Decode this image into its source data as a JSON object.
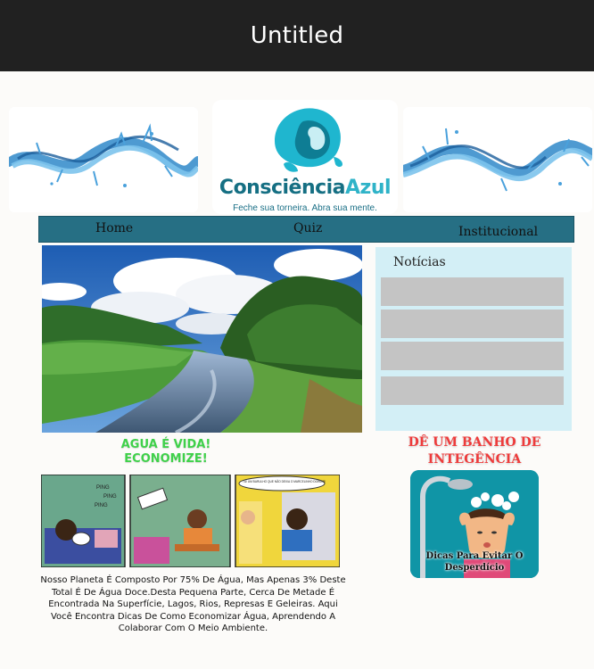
{
  "window": {
    "title": "Untitled"
  },
  "logo": {
    "name_part1": "Consciência",
    "name_part2": "Azul",
    "tagline": "Feche sua torneira. Abra sua mente."
  },
  "nav": {
    "items": [
      "Home",
      "Quiz",
      "Institucional"
    ]
  },
  "news": {
    "title": "Notícias",
    "items": [
      "",
      "",
      "",
      ""
    ]
  },
  "captions": {
    "left_line1": "AGUA É VIDA!",
    "left_line2": "ECONOMIZE!",
    "right_line1": "DÊ UM BANHO DE",
    "right_line2": "INTEGÊNCIA"
  },
  "comic": {
    "sound1": "PING",
    "sound2": "PING",
    "sound3": "PING",
    "speech": "TÁ! UM BARULHO QUE NÃO DEIXA O MARCELINHO DORMIR!"
  },
  "body_text": "Nosso Planeta É Composto Por 75% De Água, Mas Apenas 3% Deste Total É De Água Doce.Desta Pequena Parte, Cerca De Metade É Encontrada Na Superfície, Lagos, Rios, Represas E Geleiras. Aqui Você Encontra Dicas De Como Economizar Água, Aprendendo A Colaborar Com O Meio Ambiente.",
  "tips": {
    "label_line1": "Dicas Para Evitar O",
    "label_line2": "Desperdício"
  },
  "colors": {
    "titlebar": "#212121",
    "nav": "#266f84",
    "news_bg": "#d3eff6",
    "news_item": "#c4c4c4",
    "caption_green": "#3fd14a",
    "caption_red": "#ee3b3b",
    "brand_dark": "#156f83",
    "brand_light": "#2fb3c8"
  }
}
